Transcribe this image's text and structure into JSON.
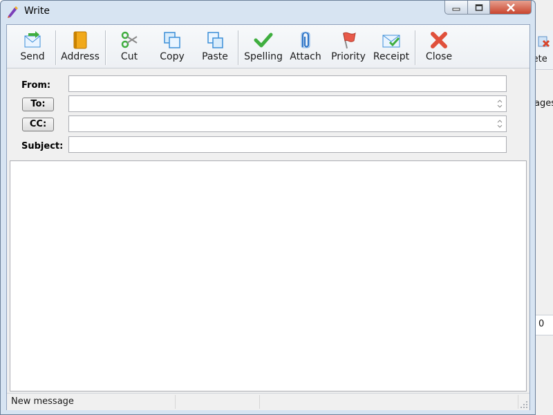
{
  "window": {
    "title": "Write"
  },
  "toolbar": {
    "buttons": [
      {
        "label": "Send",
        "icon": "send-icon"
      },
      {
        "label": "Address",
        "icon": "address-book-icon"
      },
      {
        "label": "Cut",
        "icon": "scissors-icon"
      },
      {
        "label": "Copy",
        "icon": "copy-icon"
      },
      {
        "label": "Paste",
        "icon": "paste-icon"
      },
      {
        "label": "Spelling",
        "icon": "checkmark-icon"
      },
      {
        "label": "Attach",
        "icon": "paperclip-icon"
      },
      {
        "label": "Priority",
        "icon": "flag-icon"
      },
      {
        "label": "Receipt",
        "icon": "receipt-envelope-icon"
      },
      {
        "label": "Close",
        "icon": "red-x-icon"
      }
    ]
  },
  "header": {
    "from_label": "From:",
    "to_label": "To:",
    "cc_label": "CC:",
    "subject_label": "Subject:",
    "from_value": "",
    "to_value": "",
    "cc_value": "",
    "subject_value": ""
  },
  "body": {
    "value": ""
  },
  "statusbar": {
    "message": "New message",
    "panel2": "",
    "panel3": ""
  },
  "background_window": {
    "toolbar_text": "lete",
    "text1": "ages",
    "text2": "0"
  },
  "colors": {
    "title_bar": "#d7e4f2",
    "close_button": "#c9452e",
    "accent_blue": "#3b8ed8",
    "send_green": "#3fae3f"
  }
}
